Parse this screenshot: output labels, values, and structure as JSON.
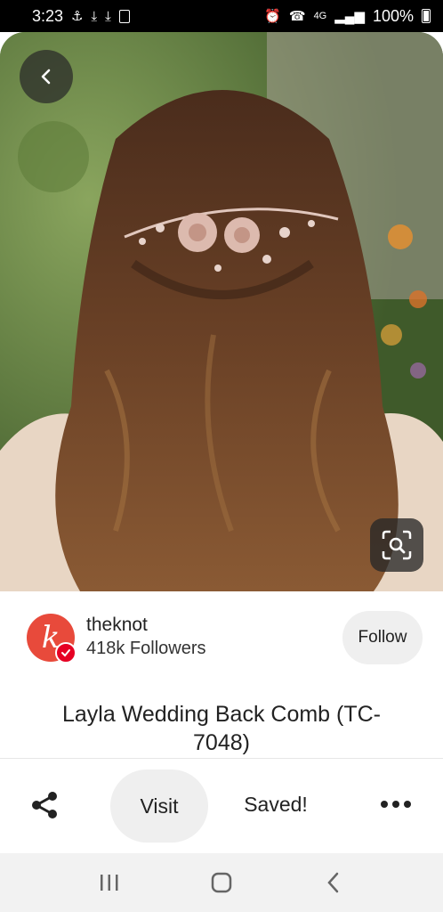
{
  "status_bar": {
    "time": "3:23",
    "left_icons": [
      "notification-icon",
      "download-icon",
      "download-icon",
      "storage-icon"
    ],
    "right_icons": [
      "alarm-icon",
      "wifi-calling-icon",
      "lte-icon",
      "signal-icon"
    ],
    "network": "4G",
    "battery": "100%"
  },
  "pin": {
    "image_alt": "Woman with long wavy brown hair wearing a floral wedding back comb",
    "title": "Layla Wedding Back Comb (TC-7048)"
  },
  "creator": {
    "avatar_letter": "k",
    "name": "theknot",
    "followers": "418k Followers",
    "follow_label": "Follow",
    "avatar_color": "#e84a3b",
    "badge_color": "#e60023"
  },
  "actions": {
    "visit_label": "Visit",
    "saved_label": "Saved!"
  },
  "icons": {
    "back": "back-arrow-icon",
    "lens": "visual-search-icon",
    "share": "share-icon",
    "more": "more-options-icon"
  }
}
